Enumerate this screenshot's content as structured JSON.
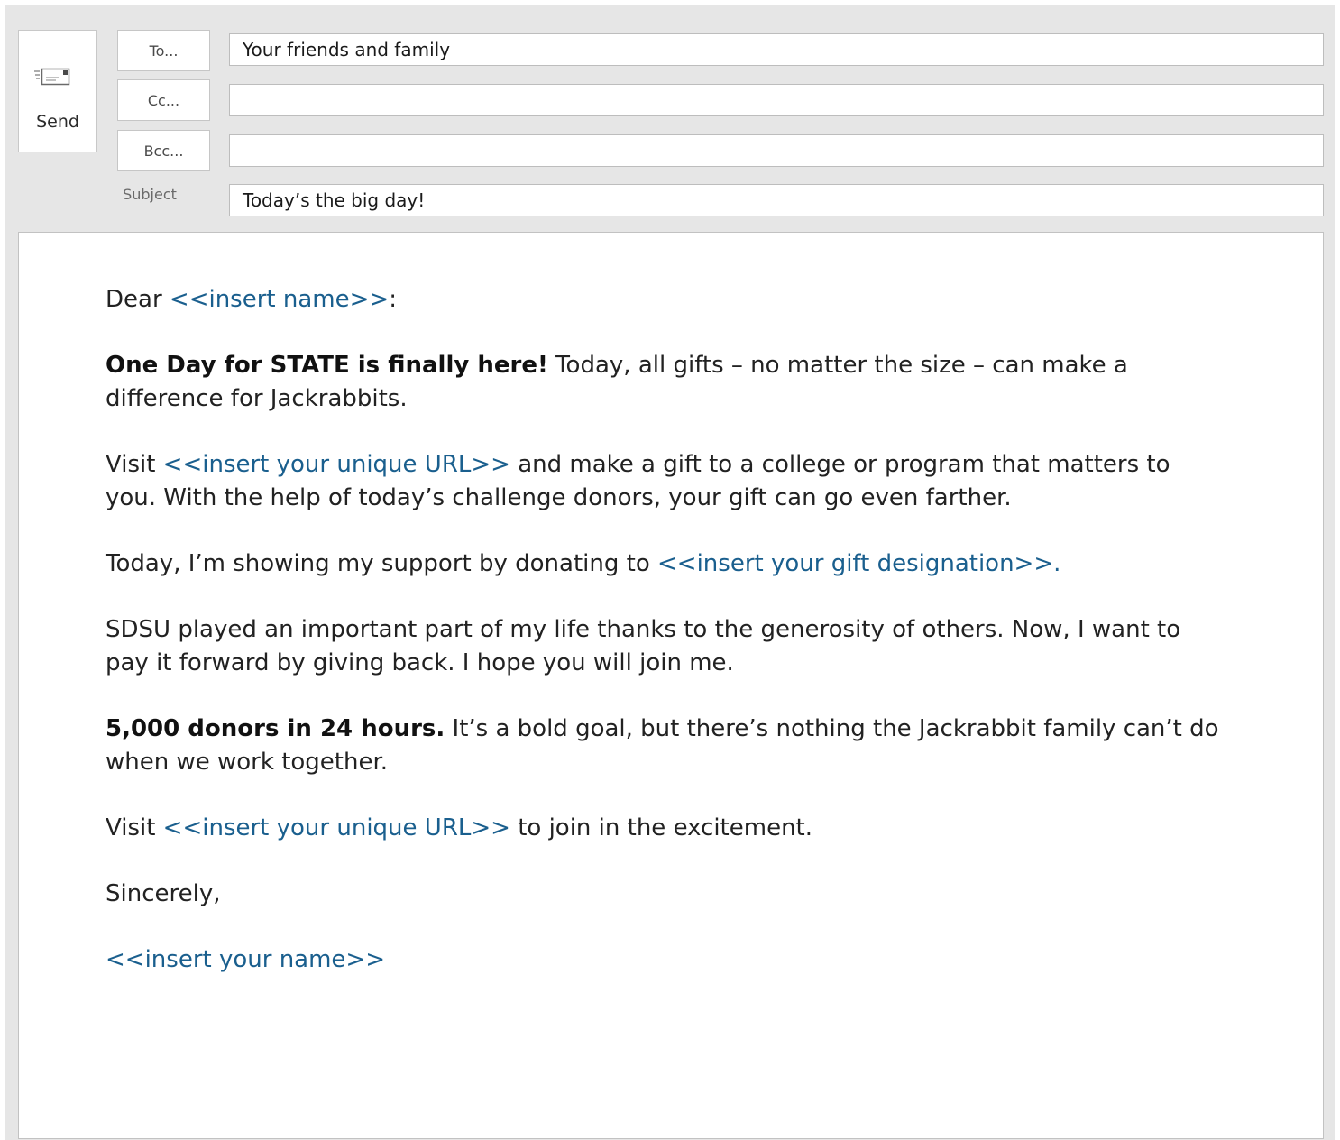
{
  "colors": {
    "placeholder": "#1a5f8e",
    "chrome": "#e6e6e6"
  },
  "compose": {
    "send_label": "Send",
    "send_icon": "send-envelope-icon",
    "to_label": "To...",
    "cc_label": "Cc...",
    "bcc_label": "Bcc...",
    "subject_label": "Subject",
    "to_value": "Your friends and family",
    "cc_value": "",
    "bcc_value": "",
    "subject_value": "Today’s the big day!"
  },
  "body": {
    "p1": {
      "before": "Dear ",
      "placeholder": "<<insert name>>",
      "after": ":"
    },
    "p2": {
      "bold": "One Day for STATE is finally here!",
      "line1_rest": " Today, all gifts – no matter the size – can make a",
      "line2": "difference for Jackrabbits."
    },
    "p3": {
      "before": "Visit ",
      "placeholder": "<<insert your unique URL>>",
      "line1_rest": " and make a gift to a college or program that matters to",
      "line2": "you. With the help of today’s challenge donors, your gift can go even farther."
    },
    "p4": {
      "before": "Today, I’m showing my support by donating to ",
      "placeholder": "<<insert your gift designation>>."
    },
    "p5": {
      "line1": "SDSU played an important part of my life thanks to the generosity of others. Now, I want to",
      "line2": "pay it forward by giving back. I hope you will join me."
    },
    "p6": {
      "bold": "5,000 donors in 24 hours.",
      "line1_rest": " It’s a bold goal, but there’s nothing the Jackrabbit family can’t do",
      "line2": "when we work together."
    },
    "p7": {
      "before": "Visit ",
      "placeholder": "<<insert your unique URL>>",
      "after": " to join in the excitement."
    },
    "p8": "Sincerely,",
    "p9": "<<insert your name>>"
  }
}
